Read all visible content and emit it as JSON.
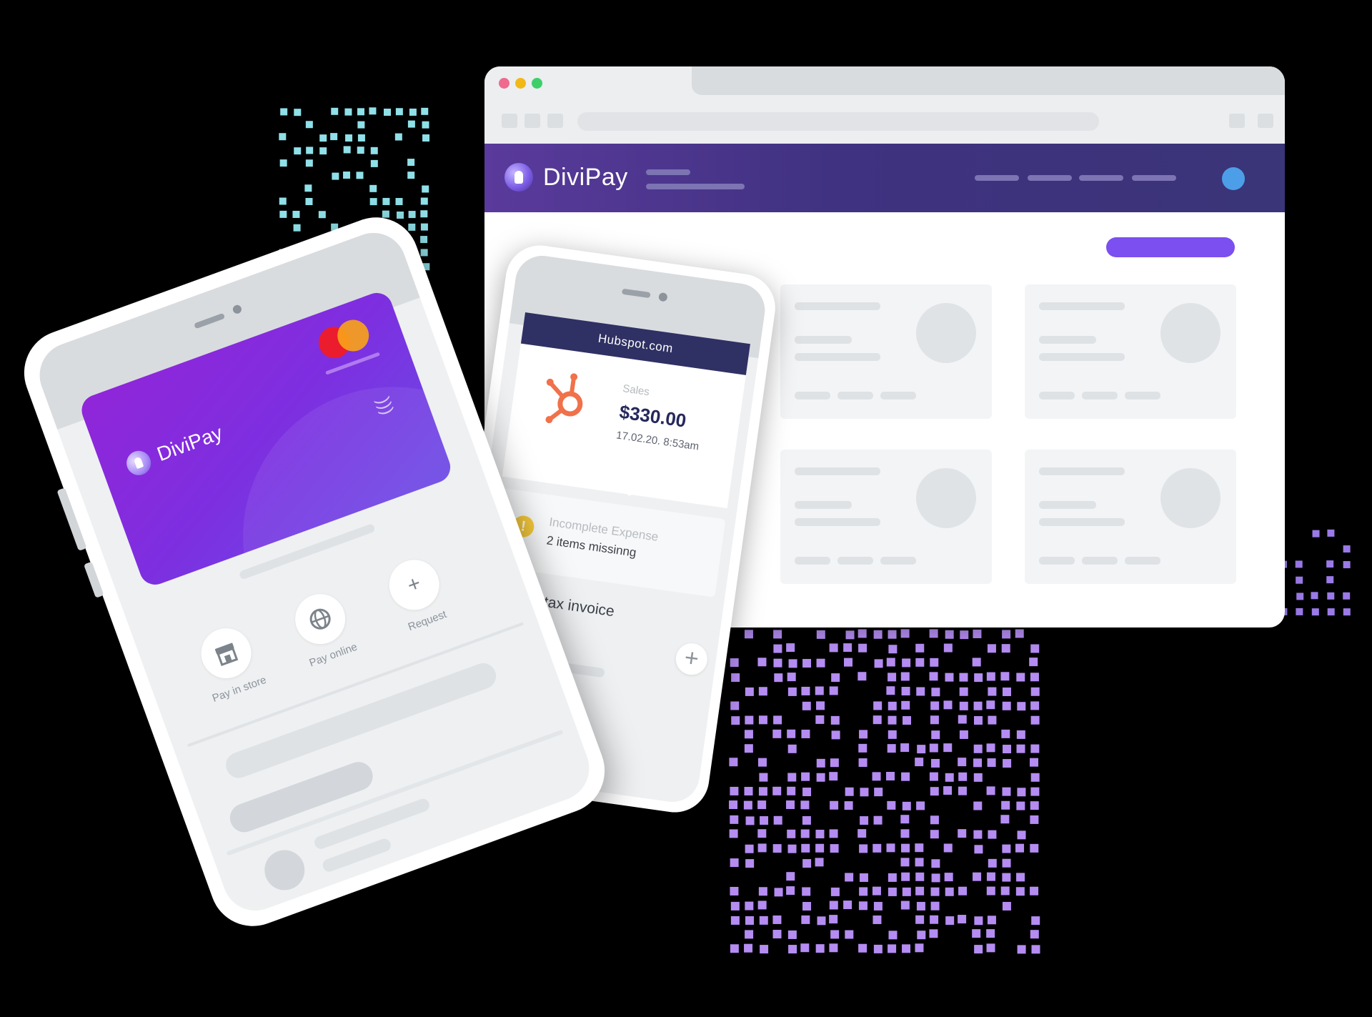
{
  "browser": {
    "brand": "DiviPay"
  },
  "receipt": {
    "merchant": "Hubspot.com",
    "category": "Sales",
    "amount": "$330.00",
    "timestamp": "17.02.20. 8:53am",
    "icon": "hubspot-icon"
  },
  "alert": {
    "title": "Incomplete Expense",
    "subtitle": "2 items missinng",
    "icon": "warning-icon"
  },
  "upload": {
    "label": "Upload tax invoice",
    "icon": "plus-icon"
  },
  "card": {
    "brand": "DiviPay",
    "network_icon": "mastercard-icon",
    "contactless_icon": "contactless-icon"
  },
  "actions": [
    {
      "label": "Pay in store",
      "icon": "store-icon"
    },
    {
      "label": "Pay online",
      "icon": "globe-icon"
    },
    {
      "label": "Request",
      "icon": "plus-icon"
    }
  ],
  "colors": {
    "appbar": "#3f3280",
    "cta": "#7b4ff0",
    "card": "#8a2be2",
    "receipt_header": "#2f3063",
    "hubspot": "#f0714a",
    "warning": "#f5c93a"
  }
}
